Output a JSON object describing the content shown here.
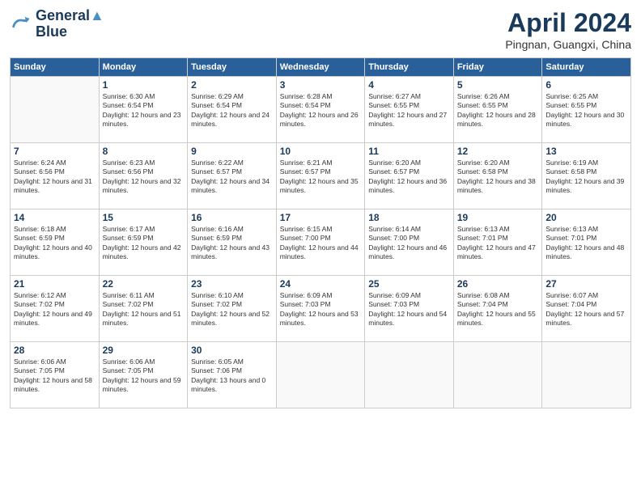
{
  "logo": {
    "line1": "General",
    "line2": "Blue"
  },
  "title": "April 2024",
  "location": "Pingnan, Guangxi, China",
  "weekdays": [
    "Sunday",
    "Monday",
    "Tuesday",
    "Wednesday",
    "Thursday",
    "Friday",
    "Saturday"
  ],
  "weeks": [
    [
      {
        "day": "",
        "sunrise": "",
        "sunset": "",
        "daylight": "",
        "empty": true
      },
      {
        "day": "1",
        "sunrise": "6:30 AM",
        "sunset": "6:54 PM",
        "daylight": "12 hours and 23 minutes."
      },
      {
        "day": "2",
        "sunrise": "6:29 AM",
        "sunset": "6:54 PM",
        "daylight": "12 hours and 24 minutes."
      },
      {
        "day": "3",
        "sunrise": "6:28 AM",
        "sunset": "6:54 PM",
        "daylight": "12 hours and 26 minutes."
      },
      {
        "day": "4",
        "sunrise": "6:27 AM",
        "sunset": "6:55 PM",
        "daylight": "12 hours and 27 minutes."
      },
      {
        "day": "5",
        "sunrise": "6:26 AM",
        "sunset": "6:55 PM",
        "daylight": "12 hours and 28 minutes."
      },
      {
        "day": "6",
        "sunrise": "6:25 AM",
        "sunset": "6:55 PM",
        "daylight": "12 hours and 30 minutes."
      }
    ],
    [
      {
        "day": "7",
        "sunrise": "6:24 AM",
        "sunset": "6:56 PM",
        "daylight": "12 hours and 31 minutes."
      },
      {
        "day": "8",
        "sunrise": "6:23 AM",
        "sunset": "6:56 PM",
        "daylight": "12 hours and 32 minutes."
      },
      {
        "day": "9",
        "sunrise": "6:22 AM",
        "sunset": "6:57 PM",
        "daylight": "12 hours and 34 minutes."
      },
      {
        "day": "10",
        "sunrise": "6:21 AM",
        "sunset": "6:57 PM",
        "daylight": "12 hours and 35 minutes."
      },
      {
        "day": "11",
        "sunrise": "6:20 AM",
        "sunset": "6:57 PM",
        "daylight": "12 hours and 36 minutes."
      },
      {
        "day": "12",
        "sunrise": "6:20 AM",
        "sunset": "6:58 PM",
        "daylight": "12 hours and 38 minutes."
      },
      {
        "day": "13",
        "sunrise": "6:19 AM",
        "sunset": "6:58 PM",
        "daylight": "12 hours and 39 minutes."
      }
    ],
    [
      {
        "day": "14",
        "sunrise": "6:18 AM",
        "sunset": "6:59 PM",
        "daylight": "12 hours and 40 minutes."
      },
      {
        "day": "15",
        "sunrise": "6:17 AM",
        "sunset": "6:59 PM",
        "daylight": "12 hours and 42 minutes."
      },
      {
        "day": "16",
        "sunrise": "6:16 AM",
        "sunset": "6:59 PM",
        "daylight": "12 hours and 43 minutes."
      },
      {
        "day": "17",
        "sunrise": "6:15 AM",
        "sunset": "7:00 PM",
        "daylight": "12 hours and 44 minutes."
      },
      {
        "day": "18",
        "sunrise": "6:14 AM",
        "sunset": "7:00 PM",
        "daylight": "12 hours and 46 minutes."
      },
      {
        "day": "19",
        "sunrise": "6:13 AM",
        "sunset": "7:01 PM",
        "daylight": "12 hours and 47 minutes."
      },
      {
        "day": "20",
        "sunrise": "6:13 AM",
        "sunset": "7:01 PM",
        "daylight": "12 hours and 48 minutes."
      }
    ],
    [
      {
        "day": "21",
        "sunrise": "6:12 AM",
        "sunset": "7:02 PM",
        "daylight": "12 hours and 49 minutes."
      },
      {
        "day": "22",
        "sunrise": "6:11 AM",
        "sunset": "7:02 PM",
        "daylight": "12 hours and 51 minutes."
      },
      {
        "day": "23",
        "sunrise": "6:10 AM",
        "sunset": "7:02 PM",
        "daylight": "12 hours and 52 minutes."
      },
      {
        "day": "24",
        "sunrise": "6:09 AM",
        "sunset": "7:03 PM",
        "daylight": "12 hours and 53 minutes."
      },
      {
        "day": "25",
        "sunrise": "6:09 AM",
        "sunset": "7:03 PM",
        "daylight": "12 hours and 54 minutes."
      },
      {
        "day": "26",
        "sunrise": "6:08 AM",
        "sunset": "7:04 PM",
        "daylight": "12 hours and 55 minutes."
      },
      {
        "day": "27",
        "sunrise": "6:07 AM",
        "sunset": "7:04 PM",
        "daylight": "12 hours and 57 minutes."
      }
    ],
    [
      {
        "day": "28",
        "sunrise": "6:06 AM",
        "sunset": "7:05 PM",
        "daylight": "12 hours and 58 minutes."
      },
      {
        "day": "29",
        "sunrise": "6:06 AM",
        "sunset": "7:05 PM",
        "daylight": "12 hours and 59 minutes."
      },
      {
        "day": "30",
        "sunrise": "6:05 AM",
        "sunset": "7:06 PM",
        "daylight": "13 hours and 0 minutes."
      },
      {
        "day": "",
        "sunrise": "",
        "sunset": "",
        "daylight": "",
        "empty": true
      },
      {
        "day": "",
        "sunrise": "",
        "sunset": "",
        "daylight": "",
        "empty": true
      },
      {
        "day": "",
        "sunrise": "",
        "sunset": "",
        "daylight": "",
        "empty": true
      },
      {
        "day": "",
        "sunrise": "",
        "sunset": "",
        "daylight": "",
        "empty": true
      }
    ]
  ]
}
